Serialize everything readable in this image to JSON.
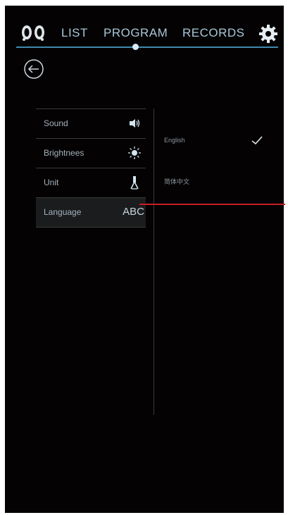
{
  "nav": {
    "tabs": [
      {
        "label": "LIST"
      },
      {
        "label": "PROGRAM"
      },
      {
        "label": "RECORDS"
      }
    ],
    "accent": "#3f89ad"
  },
  "settings": {
    "items": [
      {
        "label": "Sound",
        "icon": "speaker-icon"
      },
      {
        "label": "Brightnees",
        "icon": "sun-icon"
      },
      {
        "label": "Unit",
        "icon": "ruler-icon"
      },
      {
        "label": "Language",
        "icon": "abc-icon",
        "icon_text": "ABC",
        "selected": true
      }
    ]
  },
  "language": {
    "options": [
      {
        "label": "English",
        "selected": true
      },
      {
        "label": "简体中文",
        "selected": false
      }
    ]
  },
  "colors": {
    "background": "#040203",
    "pointer_line": "#c61f24"
  }
}
